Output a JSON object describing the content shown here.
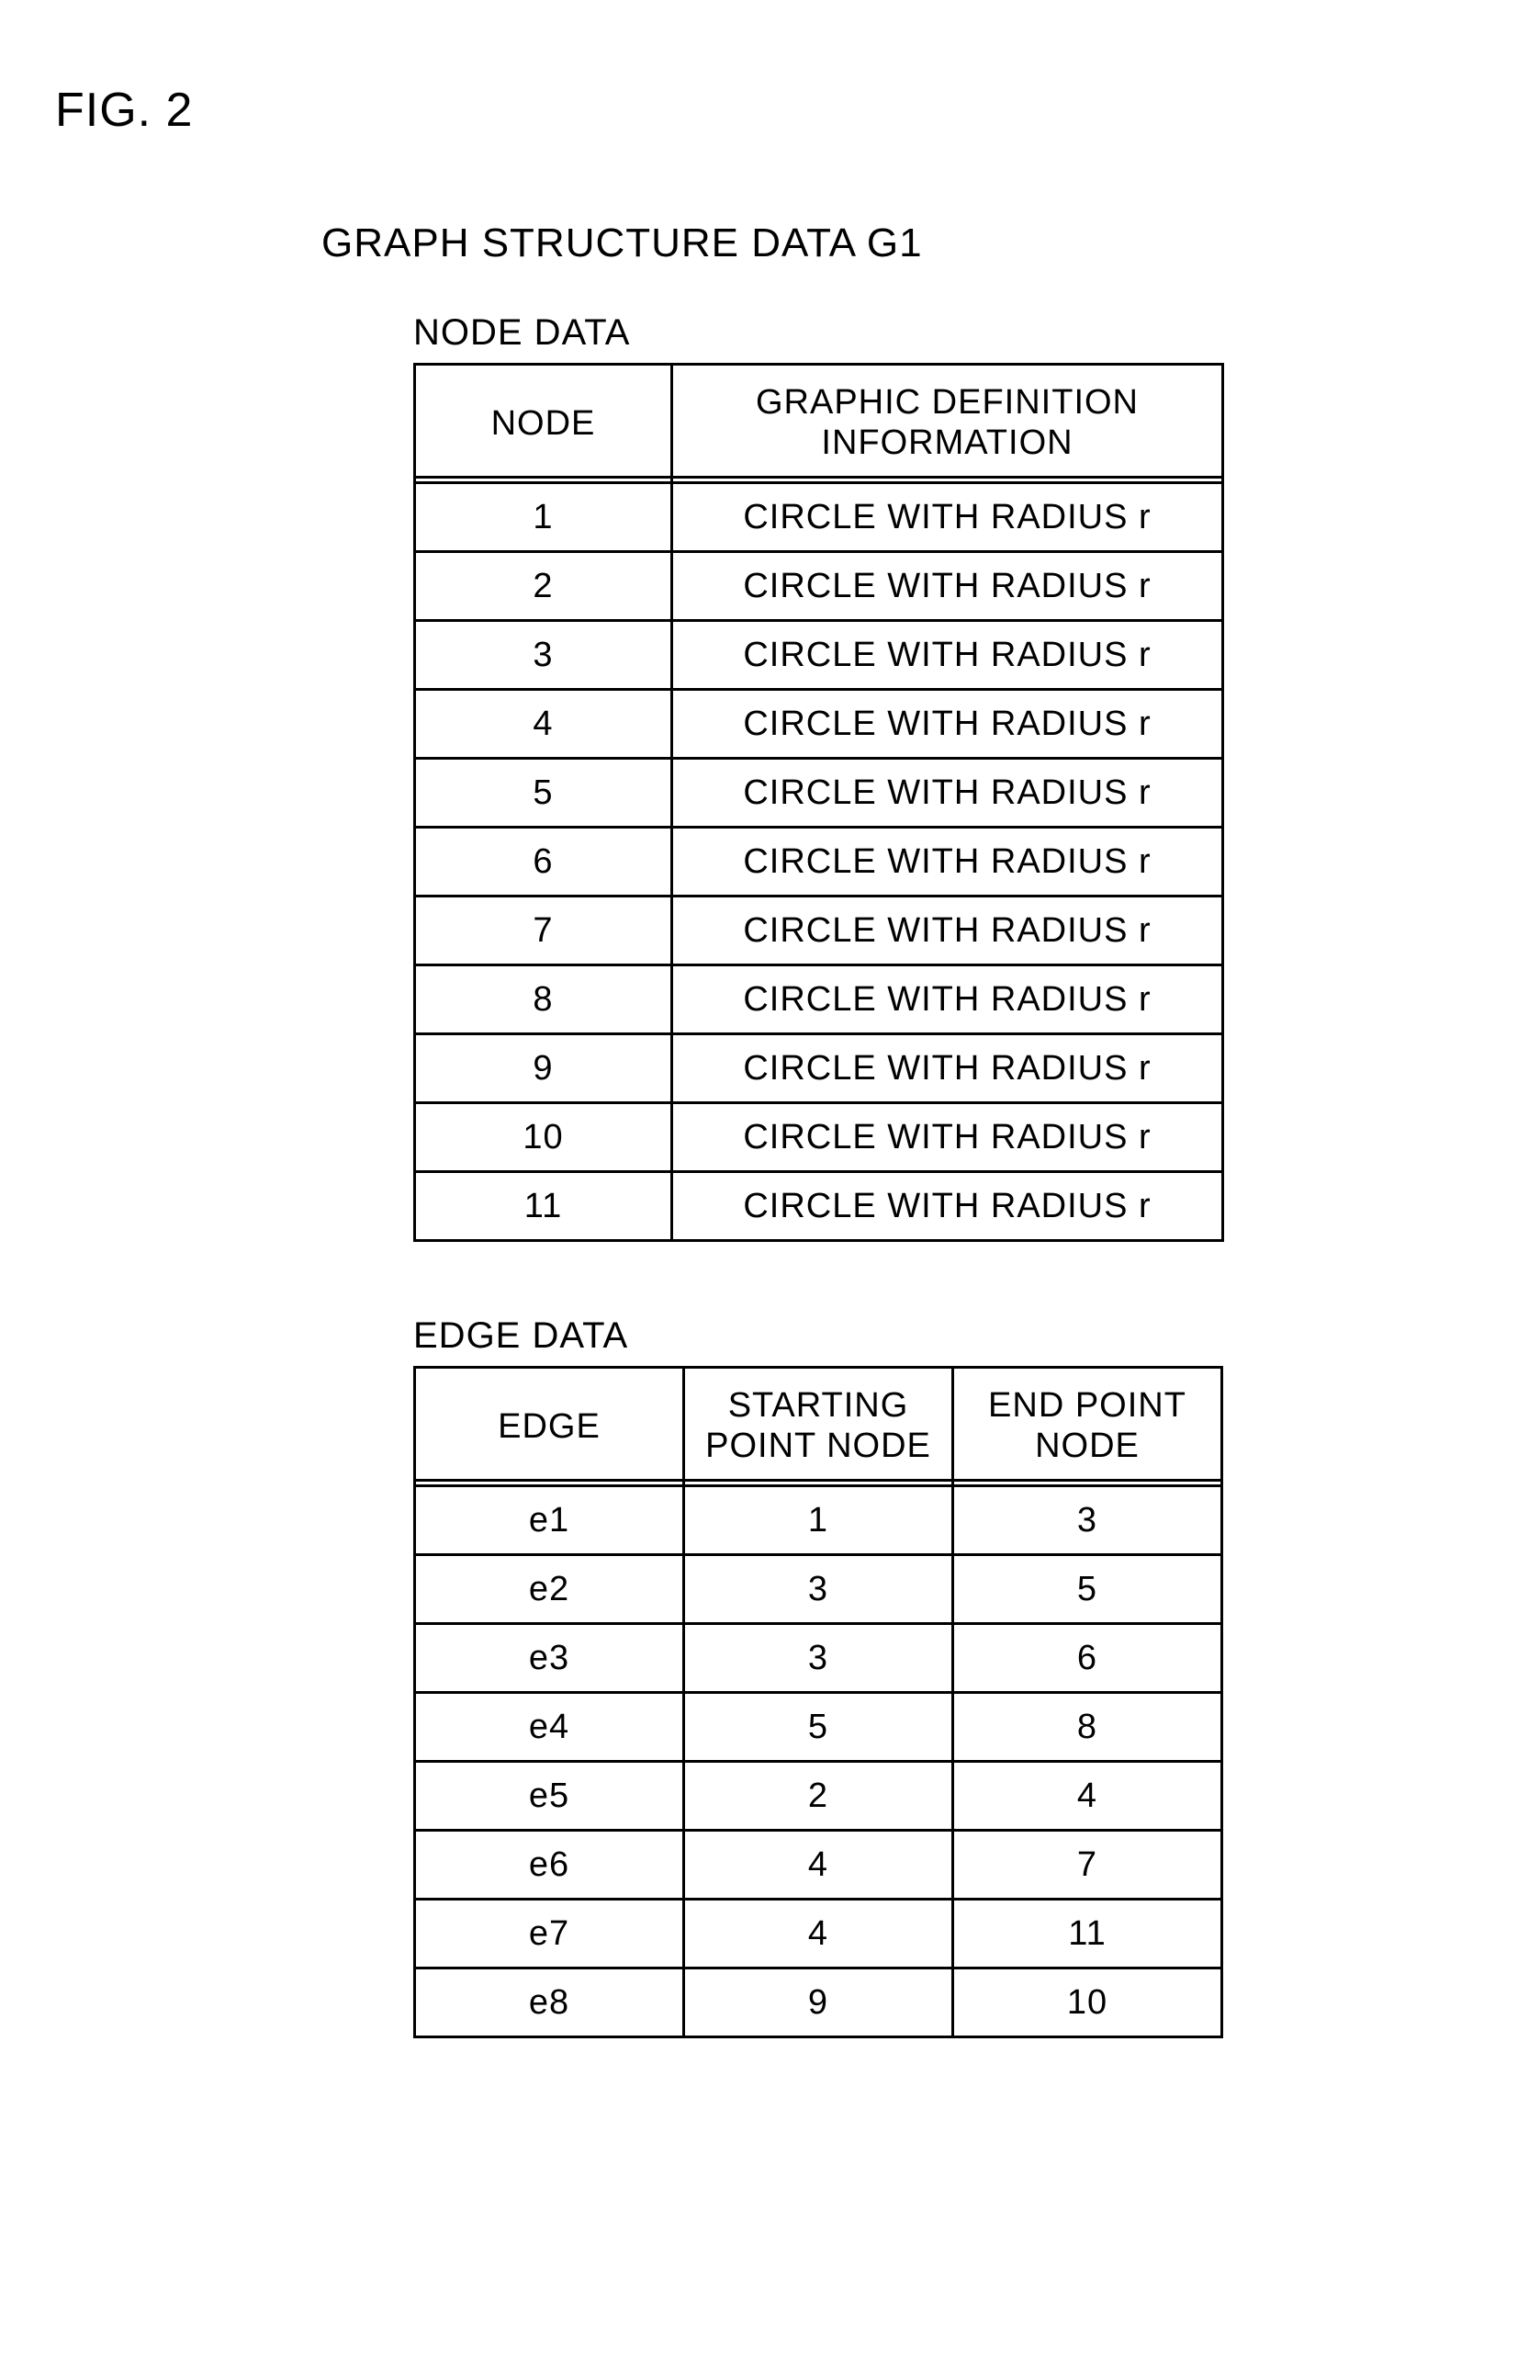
{
  "figure_label": "FIG. 2",
  "title": "GRAPH STRUCTURE DATA G1",
  "node_section_label": "NODE DATA",
  "edge_section_label": "EDGE DATA",
  "node_table": {
    "headers": {
      "node": "NODE",
      "definition": "GRAPHIC DEFINITION INFORMATION"
    },
    "rows": [
      {
        "node": "1",
        "definition": "CIRCLE WITH RADIUS r"
      },
      {
        "node": "2",
        "definition": "CIRCLE WITH RADIUS r"
      },
      {
        "node": "3",
        "definition": "CIRCLE WITH RADIUS r"
      },
      {
        "node": "4",
        "definition": "CIRCLE WITH RADIUS r"
      },
      {
        "node": "5",
        "definition": "CIRCLE WITH RADIUS r"
      },
      {
        "node": "6",
        "definition": "CIRCLE WITH RADIUS r"
      },
      {
        "node": "7",
        "definition": "CIRCLE WITH RADIUS r"
      },
      {
        "node": "8",
        "definition": "CIRCLE WITH RADIUS r"
      },
      {
        "node": "9",
        "definition": "CIRCLE WITH RADIUS r"
      },
      {
        "node": "10",
        "definition": "CIRCLE WITH RADIUS r"
      },
      {
        "node": "11",
        "definition": "CIRCLE WITH RADIUS r"
      }
    ]
  },
  "edge_table": {
    "headers": {
      "edge": "EDGE",
      "start": "STARTING POINT NODE",
      "end": "END POINT NODE"
    },
    "rows": [
      {
        "edge": "e1",
        "start": "1",
        "end": "3"
      },
      {
        "edge": "e2",
        "start": "3",
        "end": "5"
      },
      {
        "edge": "e3",
        "start": "3",
        "end": "6"
      },
      {
        "edge": "e4",
        "start": "5",
        "end": "8"
      },
      {
        "edge": "e5",
        "start": "2",
        "end": "4"
      },
      {
        "edge": "e6",
        "start": "4",
        "end": "7"
      },
      {
        "edge": "e7",
        "start": "4",
        "end": "11"
      },
      {
        "edge": "e8",
        "start": "9",
        "end": "10"
      }
    ]
  }
}
